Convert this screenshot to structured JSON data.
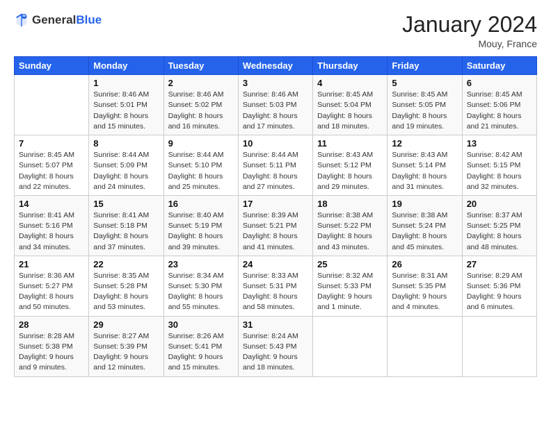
{
  "header": {
    "logo_general": "General",
    "logo_blue": "Blue",
    "month_title": "January 2024",
    "location": "Mouy, France"
  },
  "days_of_week": [
    "Sunday",
    "Monday",
    "Tuesday",
    "Wednesday",
    "Thursday",
    "Friday",
    "Saturday"
  ],
  "weeks": [
    [
      {
        "day": "",
        "sunrise": "",
        "sunset": "",
        "daylight": ""
      },
      {
        "day": "1",
        "sunrise": "Sunrise: 8:46 AM",
        "sunset": "Sunset: 5:01 PM",
        "daylight": "Daylight: 8 hours and 15 minutes."
      },
      {
        "day": "2",
        "sunrise": "Sunrise: 8:46 AM",
        "sunset": "Sunset: 5:02 PM",
        "daylight": "Daylight: 8 hours and 16 minutes."
      },
      {
        "day": "3",
        "sunrise": "Sunrise: 8:46 AM",
        "sunset": "Sunset: 5:03 PM",
        "daylight": "Daylight: 8 hours and 17 minutes."
      },
      {
        "day": "4",
        "sunrise": "Sunrise: 8:45 AM",
        "sunset": "Sunset: 5:04 PM",
        "daylight": "Daylight: 8 hours and 18 minutes."
      },
      {
        "day": "5",
        "sunrise": "Sunrise: 8:45 AM",
        "sunset": "Sunset: 5:05 PM",
        "daylight": "Daylight: 8 hours and 19 minutes."
      },
      {
        "day": "6",
        "sunrise": "Sunrise: 8:45 AM",
        "sunset": "Sunset: 5:06 PM",
        "daylight": "Daylight: 8 hours and 21 minutes."
      }
    ],
    [
      {
        "day": "7",
        "sunrise": "Sunrise: 8:45 AM",
        "sunset": "Sunset: 5:07 PM",
        "daylight": "Daylight: 8 hours and 22 minutes."
      },
      {
        "day": "8",
        "sunrise": "Sunrise: 8:44 AM",
        "sunset": "Sunset: 5:09 PM",
        "daylight": "Daylight: 8 hours and 24 minutes."
      },
      {
        "day": "9",
        "sunrise": "Sunrise: 8:44 AM",
        "sunset": "Sunset: 5:10 PM",
        "daylight": "Daylight: 8 hours and 25 minutes."
      },
      {
        "day": "10",
        "sunrise": "Sunrise: 8:44 AM",
        "sunset": "Sunset: 5:11 PM",
        "daylight": "Daylight: 8 hours and 27 minutes."
      },
      {
        "day": "11",
        "sunrise": "Sunrise: 8:43 AM",
        "sunset": "Sunset: 5:12 PM",
        "daylight": "Daylight: 8 hours and 29 minutes."
      },
      {
        "day": "12",
        "sunrise": "Sunrise: 8:43 AM",
        "sunset": "Sunset: 5:14 PM",
        "daylight": "Daylight: 8 hours and 31 minutes."
      },
      {
        "day": "13",
        "sunrise": "Sunrise: 8:42 AM",
        "sunset": "Sunset: 5:15 PM",
        "daylight": "Daylight: 8 hours and 32 minutes."
      }
    ],
    [
      {
        "day": "14",
        "sunrise": "Sunrise: 8:41 AM",
        "sunset": "Sunset: 5:16 PM",
        "daylight": "Daylight: 8 hours and 34 minutes."
      },
      {
        "day": "15",
        "sunrise": "Sunrise: 8:41 AM",
        "sunset": "Sunset: 5:18 PM",
        "daylight": "Daylight: 8 hours and 37 minutes."
      },
      {
        "day": "16",
        "sunrise": "Sunrise: 8:40 AM",
        "sunset": "Sunset: 5:19 PM",
        "daylight": "Daylight: 8 hours and 39 minutes."
      },
      {
        "day": "17",
        "sunrise": "Sunrise: 8:39 AM",
        "sunset": "Sunset: 5:21 PM",
        "daylight": "Daylight: 8 hours and 41 minutes."
      },
      {
        "day": "18",
        "sunrise": "Sunrise: 8:38 AM",
        "sunset": "Sunset: 5:22 PM",
        "daylight": "Daylight: 8 hours and 43 minutes."
      },
      {
        "day": "19",
        "sunrise": "Sunrise: 8:38 AM",
        "sunset": "Sunset: 5:24 PM",
        "daylight": "Daylight: 8 hours and 45 minutes."
      },
      {
        "day": "20",
        "sunrise": "Sunrise: 8:37 AM",
        "sunset": "Sunset: 5:25 PM",
        "daylight": "Daylight: 8 hours and 48 minutes."
      }
    ],
    [
      {
        "day": "21",
        "sunrise": "Sunrise: 8:36 AM",
        "sunset": "Sunset: 5:27 PM",
        "daylight": "Daylight: 8 hours and 50 minutes."
      },
      {
        "day": "22",
        "sunrise": "Sunrise: 8:35 AM",
        "sunset": "Sunset: 5:28 PM",
        "daylight": "Daylight: 8 hours and 53 minutes."
      },
      {
        "day": "23",
        "sunrise": "Sunrise: 8:34 AM",
        "sunset": "Sunset: 5:30 PM",
        "daylight": "Daylight: 8 hours and 55 minutes."
      },
      {
        "day": "24",
        "sunrise": "Sunrise: 8:33 AM",
        "sunset": "Sunset: 5:31 PM",
        "daylight": "Daylight: 8 hours and 58 minutes."
      },
      {
        "day": "25",
        "sunrise": "Sunrise: 8:32 AM",
        "sunset": "Sunset: 5:33 PM",
        "daylight": "Daylight: 9 hours and 1 minute."
      },
      {
        "day": "26",
        "sunrise": "Sunrise: 8:31 AM",
        "sunset": "Sunset: 5:35 PM",
        "daylight": "Daylight: 9 hours and 4 minutes."
      },
      {
        "day": "27",
        "sunrise": "Sunrise: 8:29 AM",
        "sunset": "Sunset: 5:36 PM",
        "daylight": "Daylight: 9 hours and 6 minutes."
      }
    ],
    [
      {
        "day": "28",
        "sunrise": "Sunrise: 8:28 AM",
        "sunset": "Sunset: 5:38 PM",
        "daylight": "Daylight: 9 hours and 9 minutes."
      },
      {
        "day": "29",
        "sunrise": "Sunrise: 8:27 AM",
        "sunset": "Sunset: 5:39 PM",
        "daylight": "Daylight: 9 hours and 12 minutes."
      },
      {
        "day": "30",
        "sunrise": "Sunrise: 8:26 AM",
        "sunset": "Sunset: 5:41 PM",
        "daylight": "Daylight: 9 hours and 15 minutes."
      },
      {
        "day": "31",
        "sunrise": "Sunrise: 8:24 AM",
        "sunset": "Sunset: 5:43 PM",
        "daylight": "Daylight: 9 hours and 18 minutes."
      },
      {
        "day": "",
        "sunrise": "",
        "sunset": "",
        "daylight": ""
      },
      {
        "day": "",
        "sunrise": "",
        "sunset": "",
        "daylight": ""
      },
      {
        "day": "",
        "sunrise": "",
        "sunset": "",
        "daylight": ""
      }
    ]
  ]
}
